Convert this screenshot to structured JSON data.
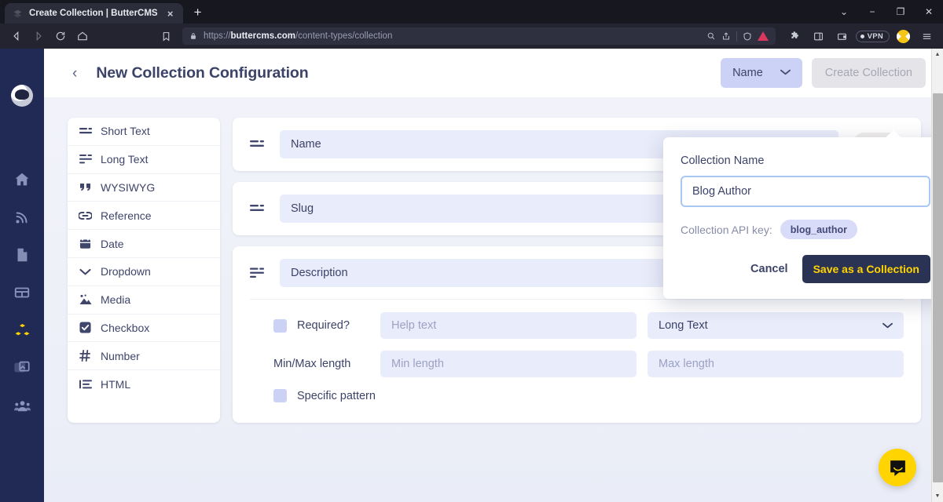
{
  "browser": {
    "tab": {
      "title": "Create Collection | ButterCMS",
      "favicon": "butter-logo-icon",
      "close": "×"
    },
    "newtab_label": "+",
    "window_controls": {
      "tab_search": "⌄",
      "minimize": "−",
      "maximize": "❐",
      "close": "✕"
    },
    "omnibox": {
      "scheme": "https://",
      "host": "buttercms.com",
      "path": "/content-types/collection",
      "lock": "lock-icon"
    },
    "vpn_badge": "VPN"
  },
  "sidebar": {
    "items": [
      {
        "name": "account-avatar",
        "label": "Account"
      },
      {
        "name": "home",
        "label": "Home"
      },
      {
        "name": "blog",
        "label": "Blog"
      },
      {
        "name": "pages",
        "label": "Pages"
      },
      {
        "name": "tables",
        "label": "Tables"
      },
      {
        "name": "collections",
        "label": "Collections",
        "active": true
      },
      {
        "name": "media",
        "label": "Media"
      },
      {
        "name": "team",
        "label": "Team"
      }
    ]
  },
  "header": {
    "back": "‹",
    "title": "New Collection Configuration",
    "name_dropdown": {
      "label": "Name",
      "chevron": "⌄"
    },
    "create_button": "Create Collection"
  },
  "field_types": [
    {
      "icon": "short-text-icon",
      "label": "Short Text"
    },
    {
      "icon": "long-text-icon",
      "label": "Long Text"
    },
    {
      "icon": "wysiwyg-icon",
      "label": "WYSIWYG"
    },
    {
      "icon": "reference-icon",
      "label": "Reference"
    },
    {
      "icon": "date-icon",
      "label": "Date"
    },
    {
      "icon": "dropdown-icon",
      "label": "Dropdown"
    },
    {
      "icon": "media-icon",
      "label": "Media"
    },
    {
      "icon": "checkbox-icon",
      "label": "Checkbox"
    },
    {
      "icon": "number-icon",
      "label": "Number"
    },
    {
      "icon": "html-icon",
      "label": "HTML"
    }
  ],
  "fields": [
    {
      "name_value": "Name",
      "api_key": "name",
      "handle": "short-text-icon"
    },
    {
      "name_value": "Slug",
      "api_key": "slug",
      "handle": "short-text-icon"
    }
  ],
  "description_field": {
    "name_value": "Description",
    "api_key": "description",
    "handle": "long-text-icon",
    "gear": "gear-icon",
    "trash": "trash-icon",
    "required_label": "Required?",
    "help_text_placeholder": "Help text",
    "type_value": "Long Text",
    "type_chevron": "⌄",
    "minmax_label": "Min/Max length",
    "min_placeholder": "Min length",
    "max_placeholder": "Max length",
    "pattern_label": "Specific pattern"
  },
  "popover": {
    "label": "Collection Name",
    "input_value": "Blog Author",
    "input_placeholder": "Collection Name",
    "api_key_label": "Collection API key:",
    "api_key_value": "blog_author",
    "cancel": "Cancel",
    "save": "Save as a Collection"
  },
  "intercom": {
    "icon": "chat-bubble-icon"
  },
  "scrollbar": {
    "up": "▲",
    "down": "▼"
  },
  "colors": {
    "rail_bg": "#212a54",
    "accent_yellow": "#ffd400",
    "page_bg": "#eceff8",
    "input_bg": "#e9ecfa",
    "dark_navy": "#2b3355",
    "danger_red": "#d9443f"
  }
}
